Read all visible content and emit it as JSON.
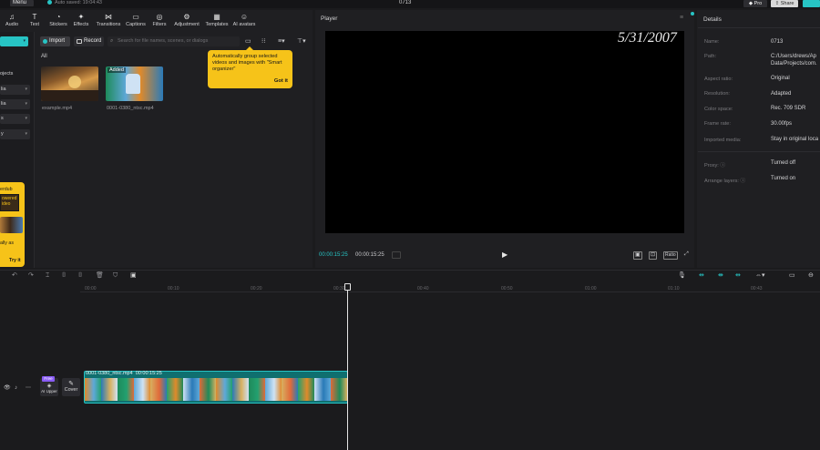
{
  "topbar": {
    "menu_label": "Menu",
    "autosave": "Auto saved: 19:04:43",
    "project_title": "0713",
    "pro_label": "Pro",
    "share_label": "Share"
  },
  "toolbar": {
    "items": [
      {
        "label": "Audio",
        "icon": "audio-icon"
      },
      {
        "label": "Text",
        "icon": "text-icon"
      },
      {
        "label": "Stickers",
        "icon": "stickers-icon"
      },
      {
        "label": "Effects",
        "icon": "effects-icon"
      },
      {
        "label": "Transitions",
        "icon": "transitions-icon"
      },
      {
        "label": "Captions",
        "icon": "captions-icon"
      },
      {
        "label": "Filters",
        "icon": "filters-icon"
      },
      {
        "label": "Adjustment",
        "icon": "adjustment-icon"
      },
      {
        "label": "Templates",
        "icon": "templates-icon"
      },
      {
        "label": "AI avatars",
        "icon": "ai-avatars-icon"
      }
    ]
  },
  "left_rail": {
    "heading": "ojects",
    "items": [
      "",
      "lia",
      "s",
      "y"
    ]
  },
  "promo": {
    "line1": "erdub",
    "box_line1": "owered",
    "box_line2": "ideo",
    "line2": "ally as",
    "cta": "Try it"
  },
  "media": {
    "import_label": "Import",
    "record_label": "Record",
    "search_placeholder": "Search for file names, scenes, or dialogs",
    "all_label": "All",
    "files": [
      {
        "name": "example.mp4",
        "badge": ""
      },
      {
        "name": "0001-0380_ntsc.mp4",
        "badge": "Added"
      }
    ]
  },
  "tooltip": {
    "text": "Automatically group selected videos and images with \"Smart organizer\"",
    "button": "Got it"
  },
  "player": {
    "title": "Player",
    "overlay_date": "5/31/2007",
    "current_time": "00:00:15:25",
    "total_time": "00:00:15:25",
    "ratio_label": "Ratio"
  },
  "details": {
    "title": "Details",
    "rows": [
      {
        "label": "Name:",
        "value": "0713"
      },
      {
        "label": "Path:",
        "value": "C:/Users/drews/Ap",
        "value2": "Data/Projects/com."
      },
      {
        "label": "Aspect ratio:",
        "value": "Original"
      },
      {
        "label": "Resolution:",
        "value": "Adapted"
      },
      {
        "label": "Color space:",
        "value": "Rec. 709 SDR"
      },
      {
        "label": "Frame rate:",
        "value": "30.00fps"
      },
      {
        "label": "Imported media:",
        "value": "Stay in original loca"
      },
      {
        "label": "Proxy:",
        "value": "Turned off"
      },
      {
        "label": "Arrange layers:",
        "value": "Turned on"
      }
    ]
  },
  "timeline": {
    "ticks": [
      "00:00",
      "00:10",
      "00:20",
      "00:30",
      "00:40",
      "00:50",
      "01:00",
      "01:10",
      "00:43"
    ],
    "clip_name": "0001-0380_ntsc.mp4",
    "clip_duration": "00:00:15:25",
    "ai_upper_label": "AI Upper",
    "free_badge": "Free",
    "cover_label": "Cover"
  },
  "colors": {
    "accent": "#27c4c4",
    "promo": "#f6c319",
    "panel": "#1f1f22"
  }
}
